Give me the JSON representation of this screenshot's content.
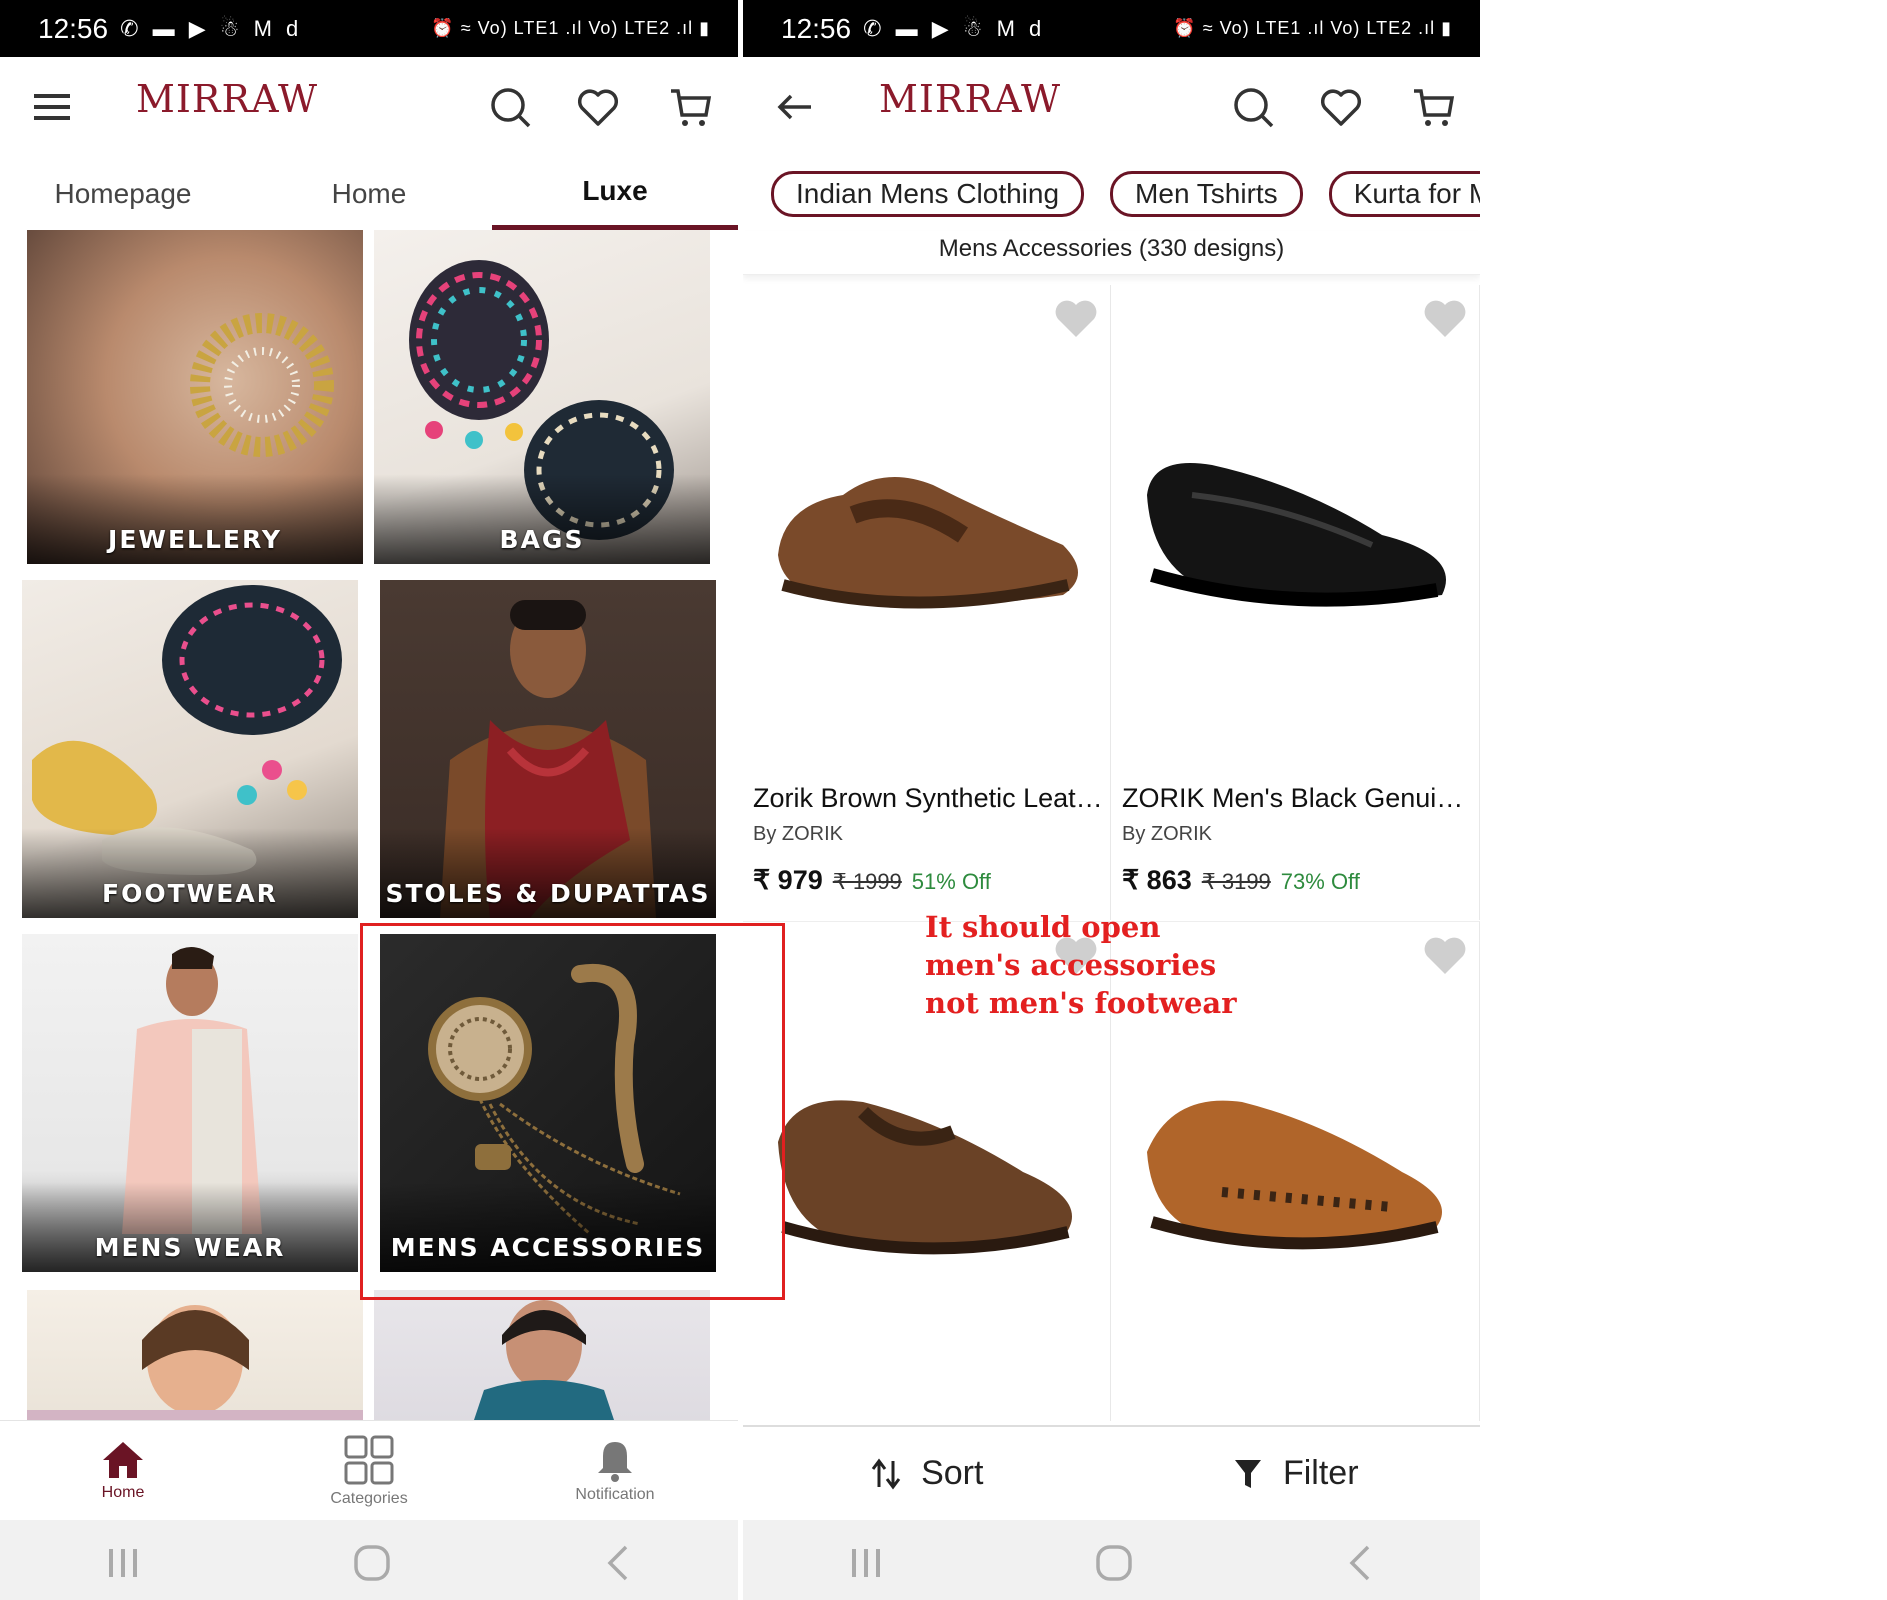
{
  "left": {
    "status": {
      "time": "12:56",
      "icons": "✆ ▬ ▶ ☃ M d",
      "right": "⏰ ≈ Vo) LTE1 .ıl Vo) LTE2 .ıl ▮"
    },
    "logo": "MIRRAW",
    "icons": {
      "menu": "hamburger-menu-icon",
      "search": "search-icon",
      "wishlist": "heart-icon",
      "cart": "cart-icon"
    },
    "tabs": [
      {
        "label": "Homepage"
      },
      {
        "label": "Home"
      },
      {
        "label": "Luxe"
      }
    ],
    "tiles": [
      {
        "label": "JEWELLERY"
      },
      {
        "label": "BAGS"
      },
      {
        "label": "FOOTWEAR"
      },
      {
        "label": "STOLES & DUPATTAS"
      },
      {
        "label": "MENS WEAR"
      },
      {
        "label": "MENS ACCESSORIES"
      }
    ],
    "bottom_nav": [
      {
        "label": "Home"
      },
      {
        "label": "Categories"
      },
      {
        "label": "Notification"
      }
    ]
  },
  "right": {
    "status": {
      "time": "12:56",
      "icons": "✆ ▬ ▶ ☃ M d",
      "right": "⏰ ≈ Vo) LTE1 .ıl Vo) LTE2 .ıl ▮"
    },
    "logo": "MIRRAW",
    "chips": [
      {
        "label": "Indian Mens Clothing"
      },
      {
        "label": "Men Tshirts"
      },
      {
        "label": "Kurta for Men"
      }
    ],
    "subtitle": "Mens Accessories (330 designs)",
    "products": [
      {
        "name": "Zorik Brown Synthetic Leat…",
        "brand": "By ZORIK",
        "price": "₹ 979",
        "original": "₹ 1999",
        "discount": "51% Off"
      },
      {
        "name": "ZORIK Men's Black Genuin…",
        "brand": "By ZORIK",
        "price": "₹ 863",
        "original": "₹ 3199",
        "discount": "73% Off"
      }
    ],
    "sort_label": "Sort",
    "filter_label": "Filter"
  },
  "annotation": {
    "line1": "It should open",
    "line2": "men's accessories",
    "line3": "not men's footwear",
    "color": "#e32020"
  },
  "colors": {
    "brand": "#6a1425",
    "discount": "#2e8b3e"
  }
}
